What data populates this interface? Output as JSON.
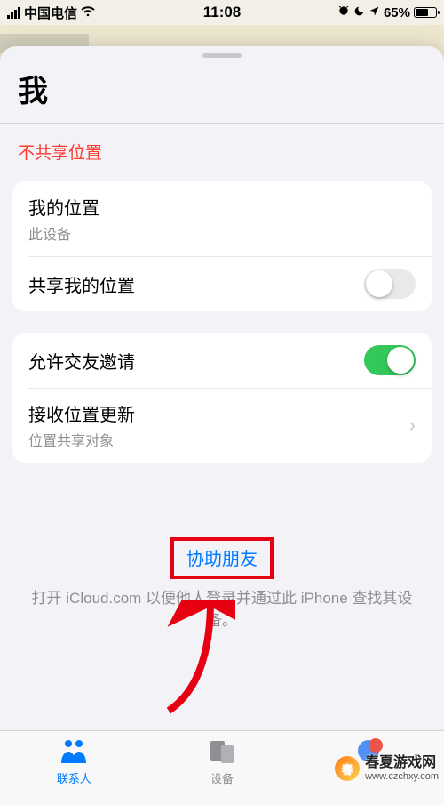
{
  "statusbar": {
    "carrier": "中国电信",
    "time": "11:08",
    "battery_pct": "65%"
  },
  "sheet": {
    "title": "我",
    "not_sharing": "不共享位置"
  },
  "group1": {
    "my_location_title": "我的位置",
    "my_location_sub": "此设备",
    "share_location_title": "共享我的位置",
    "share_location_on": false
  },
  "group2": {
    "allow_requests_title": "允许交友邀请",
    "allow_requests_on": true,
    "receive_updates_title": "接收位置更新",
    "receive_updates_sub": "位置共享对象"
  },
  "help": {
    "link": "协助朋友",
    "desc": "打开 iCloud.com 以便他人登录并通过此 iPhone 查找其设备。"
  },
  "tabs": {
    "people": "联系人",
    "devices": "设备"
  },
  "watermark": {
    "text": "春夏游戏网",
    "url": "www.czchxy.com"
  }
}
